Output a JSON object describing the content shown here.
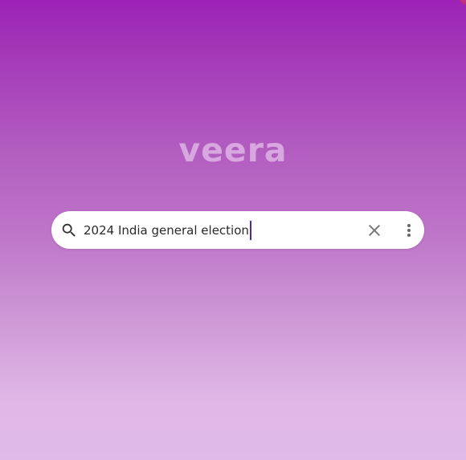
{
  "app": {
    "logo_text": "veera"
  },
  "search": {
    "query": "2024 India general election",
    "search_icon": "search-icon",
    "clear_icon": "close-icon",
    "menu_icon": "more-vert-icon"
  },
  "colors": {
    "background_top": "#9c22b6",
    "background_bottom": "#e0bbe7",
    "logo": "#dcaee3",
    "search_bg": "#ffffff",
    "caret": "#4a2aa0"
  }
}
